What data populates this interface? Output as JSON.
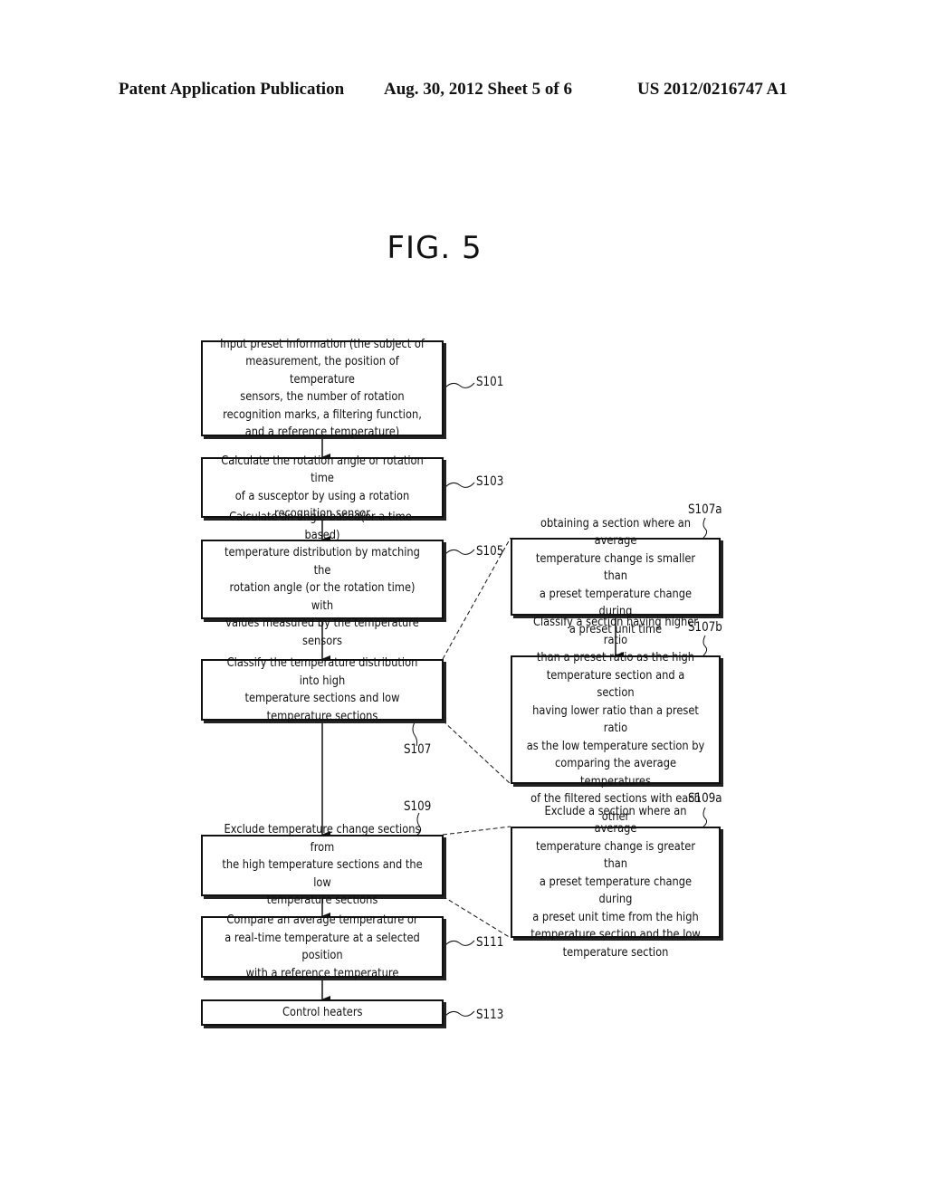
{
  "header": {
    "publication": "Patent Application Publication",
    "date_sheet": "Aug. 30, 2012   Sheet 5 of 6",
    "number": "US 2012/0216747 A1"
  },
  "figure": {
    "title": "FIG. 5"
  },
  "steps": [
    {
      "id": "S101",
      "text": "Input preset information (the subject of\nmeasurement, the position of temperature\nsensors, the number of rotation\nrecognition marks, a filtering function,\nand a reference temperature)"
    },
    {
      "id": "S103",
      "text": "Calculate the rotation angle or rotation time\nof a susceptor by using a rotation\nrecognition sensor"
    },
    {
      "id": "S105",
      "text": "Calculate an angle-based(or a time-based)\ntemperature distribution by matching the\nrotation angle (or the rotation time) with\nvalues measured by the temperature sensors"
    },
    {
      "id": "S107",
      "text": "Classify the temperature distribution into high\ntemperature sections and low\ntemperature sections"
    },
    {
      "id": "S107a",
      "text": "obtaining a section where an average\ntemperature change is smaller than\na preset temperature change during\na preset unit time"
    },
    {
      "id": "S107b",
      "text": "Classify a section having higher ratio\nthan a preset ratio as the high\ntemperature section and a section\nhaving lower ratio than a preset ratio\nas the low temperature section by\ncomparing the average temperatures\nof the filtered sections with each other"
    },
    {
      "id": "S109",
      "text": "Exclude temperature change sections from\nthe high temperature sections and the low\ntemperature sections"
    },
    {
      "id": "S109a",
      "text": "Exclude a section where an average\ntemperature change is greater than\na preset temperature change during\na preset unit time from the high\ntemperature section and the low\ntemperature section"
    },
    {
      "id": "S111",
      "text": "Compare an average temperature or\na real-time temperature at a selected position\nwith a reference temperature"
    },
    {
      "id": "S113",
      "text": "Control heaters"
    }
  ]
}
